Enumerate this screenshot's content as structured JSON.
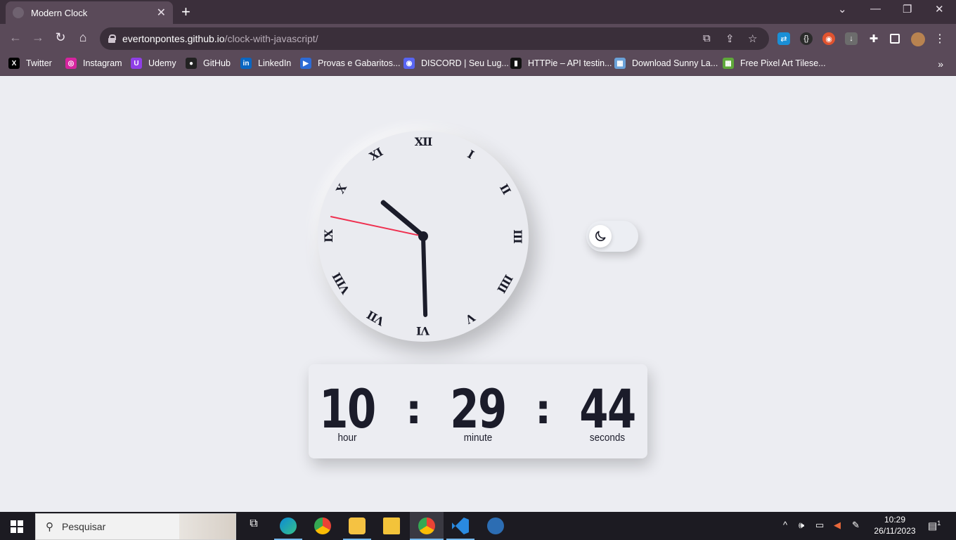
{
  "browser": {
    "tab_title": "Modern Clock",
    "tab_close": "✕",
    "new_tab": "+",
    "url_host": "evertonpontes.github.io",
    "url_path": "/clock-with-javascript/",
    "bookmarks": [
      {
        "label": "Twitter",
        "color": "#000000",
        "glyph": "X"
      },
      {
        "label": "Instagram",
        "color": "#d6249f",
        "glyph": "◎"
      },
      {
        "label": "Udemy",
        "color": "#8f3fe6",
        "glyph": "U"
      },
      {
        "label": "GitHub",
        "color": "#222222",
        "glyph": "●"
      },
      {
        "label": "LinkedIn",
        "color": "#0a66c2",
        "glyph": "in"
      },
      {
        "label": "Provas e Gabaritos...",
        "color": "#2d6bd6",
        "glyph": "▶"
      },
      {
        "label": "DISCORD | Seu Lug...",
        "color": "#5865f2",
        "glyph": "◉"
      },
      {
        "label": "HTTPie – API testin...",
        "color": "#111111",
        "glyph": "▮"
      },
      {
        "label": "Download Sunny La...",
        "color": "#6aa1d8",
        "glyph": "▦"
      },
      {
        "label": "Free Pixel Art Tilese...",
        "color": "#5fa83a",
        "glyph": "▦"
      }
    ],
    "bookmarks_more": "»"
  },
  "clock": {
    "numerals": [
      "XII",
      "I",
      "II",
      "III",
      "IIII",
      "V",
      "VI",
      "VII",
      "VIII",
      "IX",
      "X",
      "XI"
    ],
    "hour": "10",
    "minute": "29",
    "seconds": "44",
    "hour_label": "hour",
    "minute_label": "minute",
    "seconds_label": "seconds",
    "separator": ":",
    "hand_color_second": "#ef2f4f",
    "hand_color": "#1b1c2a"
  },
  "theme_toggle": {
    "icon": "moon-icon",
    "state": "light"
  },
  "taskbar": {
    "search_placeholder": "Pesquisar",
    "time": "10:29",
    "date": "26/11/2023",
    "notification_count": "1"
  }
}
